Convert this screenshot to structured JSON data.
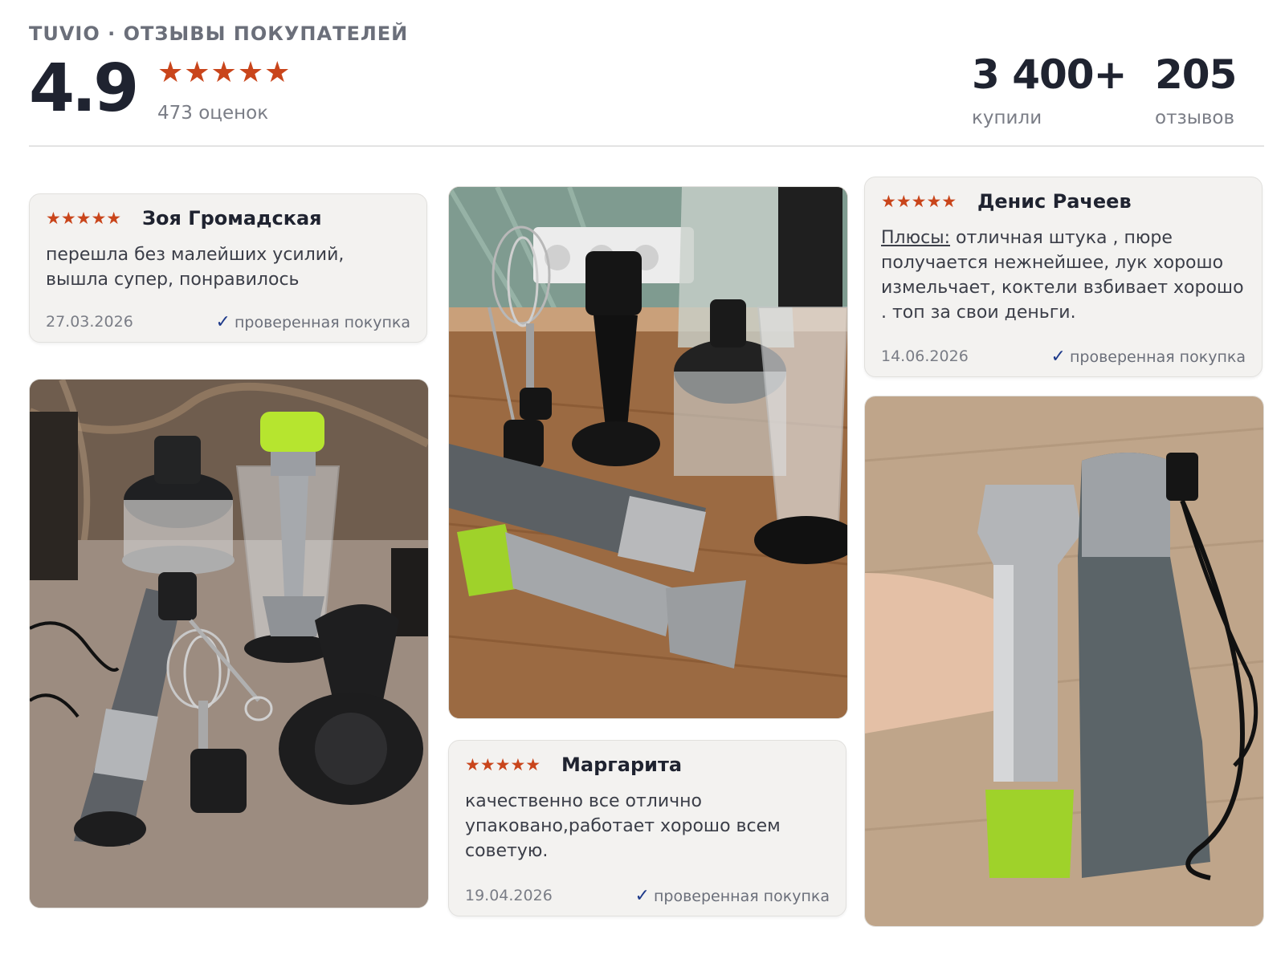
{
  "header": {
    "brand": "TUVIO · ОТЗЫВЫ ПОКУПАТЕЛЕЙ",
    "rating": "4.9",
    "stars": "★★★★★",
    "ratings_count": "473 оценок",
    "stats": [
      {
        "value": "3 400+",
        "label": "купили"
      },
      {
        "value": "205",
        "label": "отзывов"
      }
    ]
  },
  "colors": {
    "star": "#c9451b",
    "check": "#1e3a8a",
    "accent_green": "#9fd22a"
  },
  "reviews": [
    {
      "stars": "★★★★★",
      "name": "Зоя Громадская",
      "text": "перешла без малейших усилий, вышла супер, понравилось",
      "date": "27.03.2026",
      "verified": "проверенная покупка"
    },
    {
      "stars": "★★★★★",
      "name": "Денис Рачеев",
      "pros_label": "Плюсы:",
      "text": " отличная штука , пюре получается нежнейшее, лук хорошо измельчает, коктели взбивает хорошо . топ за свои деньги.",
      "date": "14.06.2026",
      "verified": "проверенная покупка"
    },
    {
      "stars": "★★★★★",
      "name": "Маргарита",
      "text": "качественно все отлично упаковано,работает хорошо всем советую.",
      "date": "19.04.2026",
      "verified": "проверенная покупка"
    }
  ],
  "icons": {
    "check": "check-icon",
    "star": "star-icon"
  }
}
